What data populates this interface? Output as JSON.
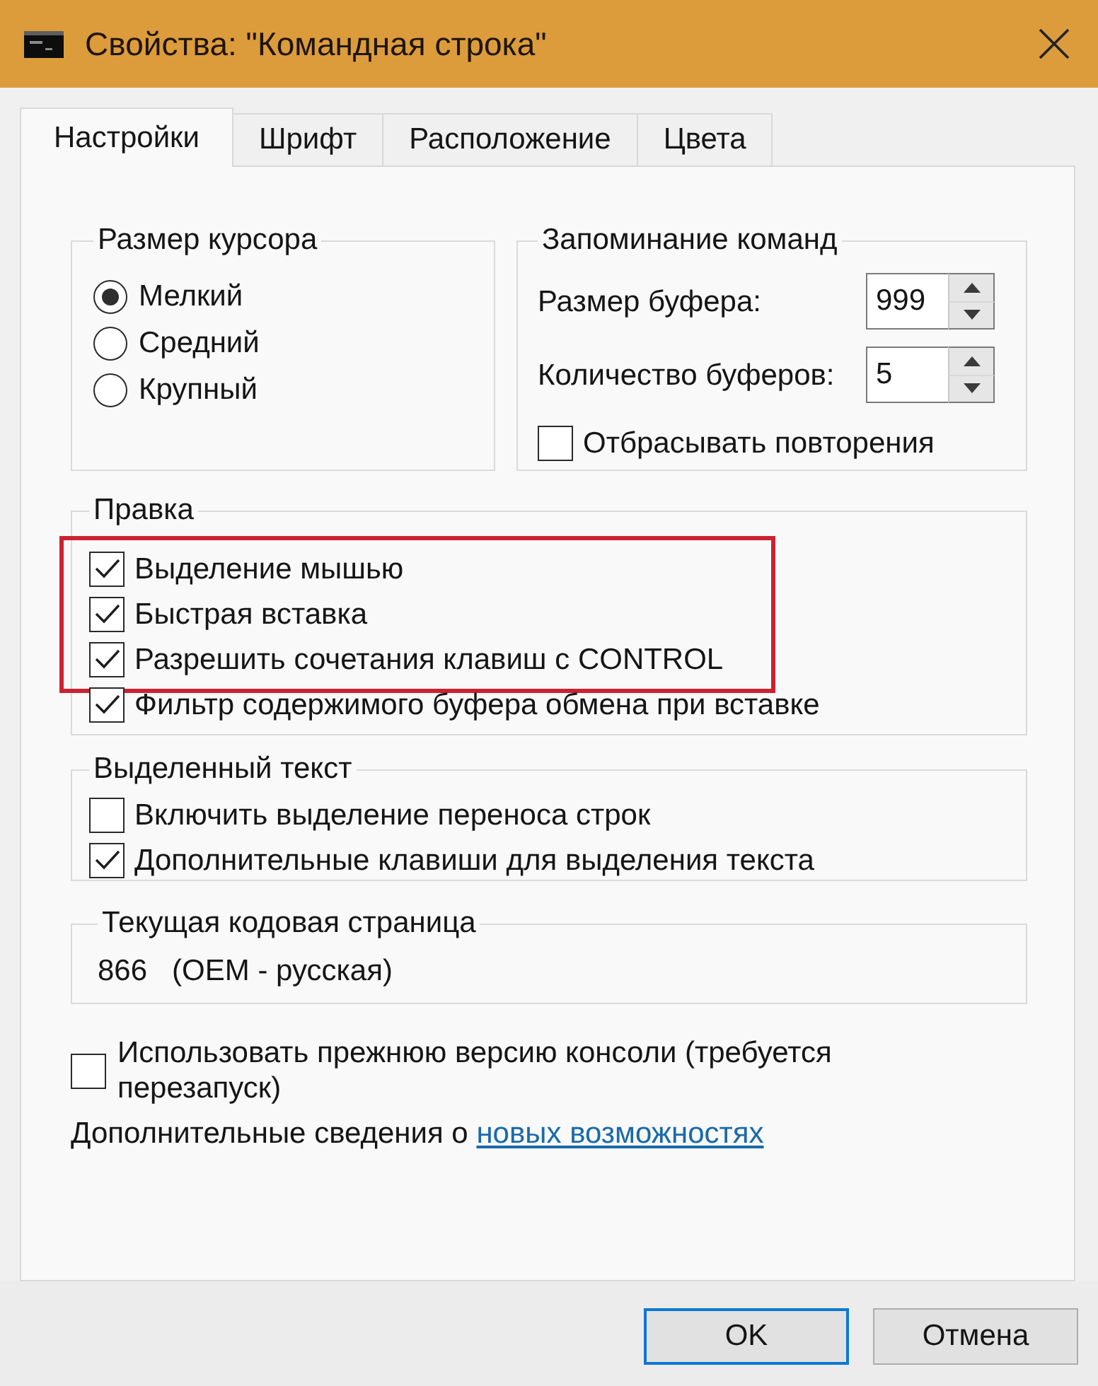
{
  "window": {
    "title": "Свойства: \"Командная строка\""
  },
  "tabs": [
    {
      "label": "Настройки",
      "selected": true
    },
    {
      "label": "Шрифт",
      "selected": false
    },
    {
      "label": "Расположение",
      "selected": false
    },
    {
      "label": "Цвета",
      "selected": false
    }
  ],
  "cursor_size": {
    "title": "Размер курсора",
    "options": [
      {
        "label": "Мелкий",
        "selected": true
      },
      {
        "label": "Средний",
        "selected": false
      },
      {
        "label": "Крупный",
        "selected": false
      }
    ]
  },
  "command_history": {
    "title": "Запоминание команд",
    "fields": [
      {
        "label": "Размер буфера:",
        "value": "999"
      },
      {
        "label": "Количество буферов:",
        "value": "5"
      }
    ],
    "discard_duplicates": {
      "label": "Отбрасывать повторения",
      "checked": false
    }
  },
  "edit_options": {
    "title": "Правка",
    "items": [
      {
        "label": "Выделение мышью",
        "checked": true,
        "highlighted": true
      },
      {
        "label": "Быстрая вставка",
        "checked": true,
        "highlighted": true
      },
      {
        "label": "Разрешить сочетания клавиш с CONTROL",
        "checked": true,
        "highlighted": true
      },
      {
        "label": "Фильтр содержимого буфера обмена при вставке",
        "checked": true,
        "highlighted": false
      }
    ]
  },
  "text_selection": {
    "title": "Выделенный текст",
    "items": [
      {
        "label": "Включить выделение переноса строк",
        "checked": false
      },
      {
        "label": "Дополнительные клавиши для выделения текста",
        "checked": true
      }
    ]
  },
  "code_page": {
    "title": "Текущая кодовая страница",
    "value": "866   (OEM - русская)"
  },
  "legacy_console": {
    "label": "Использовать прежнюю версию консоли (требуется перезапуск)",
    "checked": false
  },
  "more_info": {
    "text": "Дополнительные сведения о",
    "link": "новых возможностях"
  },
  "buttons": [
    {
      "label": "OK",
      "default": true
    },
    {
      "label": "Отмена",
      "default": false
    }
  ]
}
